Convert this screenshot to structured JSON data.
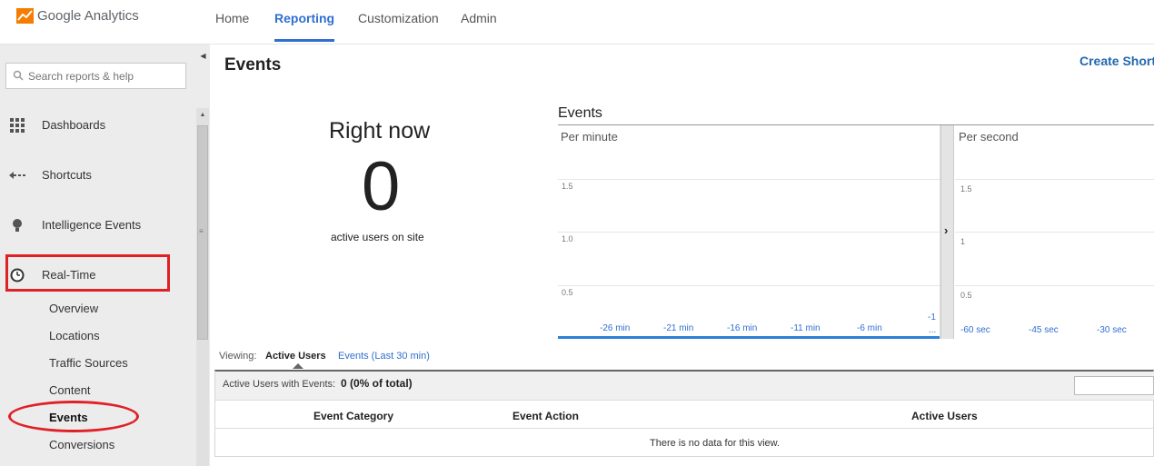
{
  "header": {
    "logo_text": "Google Analytics",
    "nav": [
      {
        "label": "Home",
        "active": false
      },
      {
        "label": "Reporting",
        "active": true
      },
      {
        "label": "Customization",
        "active": false
      },
      {
        "label": "Admin",
        "active": false
      }
    ]
  },
  "sidebar": {
    "search_placeholder": "Search reports & help",
    "items": [
      {
        "label": "Dashboards",
        "icon": "grid-icon"
      },
      {
        "label": "Shortcuts",
        "icon": "arrow-icon"
      },
      {
        "label": "Intelligence Events",
        "icon": "lightbulb-icon"
      },
      {
        "label": "Real-Time",
        "icon": "clock-icon"
      }
    ],
    "realtime_subitems": [
      {
        "label": "Overview",
        "active": false
      },
      {
        "label": "Locations",
        "active": false
      },
      {
        "label": "Traffic Sources",
        "active": false
      },
      {
        "label": "Content",
        "active": false
      },
      {
        "label": "Events",
        "active": true
      },
      {
        "label": "Conversions",
        "active": false
      }
    ]
  },
  "main": {
    "title": "Events",
    "create_shortcut": "Create Shortc",
    "right_now": {
      "label": "Right now",
      "value": "0",
      "sub_label": "active users on site"
    },
    "chart_section_title": "Events",
    "viewing": {
      "label": "Viewing:",
      "active_tab": "Active Users",
      "other_tab": "Events (Last 30 min)"
    },
    "summary": {
      "label": "Active Users with Events:",
      "value": "0 (0% of total)"
    },
    "table": {
      "columns": [
        "Event Category",
        "Event Action",
        "Active Users"
      ],
      "empty_message": "There is no data for this view."
    }
  },
  "chart_data": [
    {
      "type": "bar",
      "panel_label": "Per minute",
      "y_ticks": [
        "1.5",
        "1.0",
        "0.5"
      ],
      "x_ticks": [
        "-26 min",
        "-21 min",
        "-16 min",
        "-11 min",
        "-6 min",
        "-1"
      ],
      "x_tick_extra": "...",
      "values": []
    },
    {
      "type": "bar",
      "panel_label": "Per second",
      "y_ticks": [
        "1.5",
        "1",
        "0.5"
      ],
      "x_ticks": [
        "-60 sec",
        "-45 sec",
        "-30 sec"
      ],
      "values": []
    }
  ]
}
